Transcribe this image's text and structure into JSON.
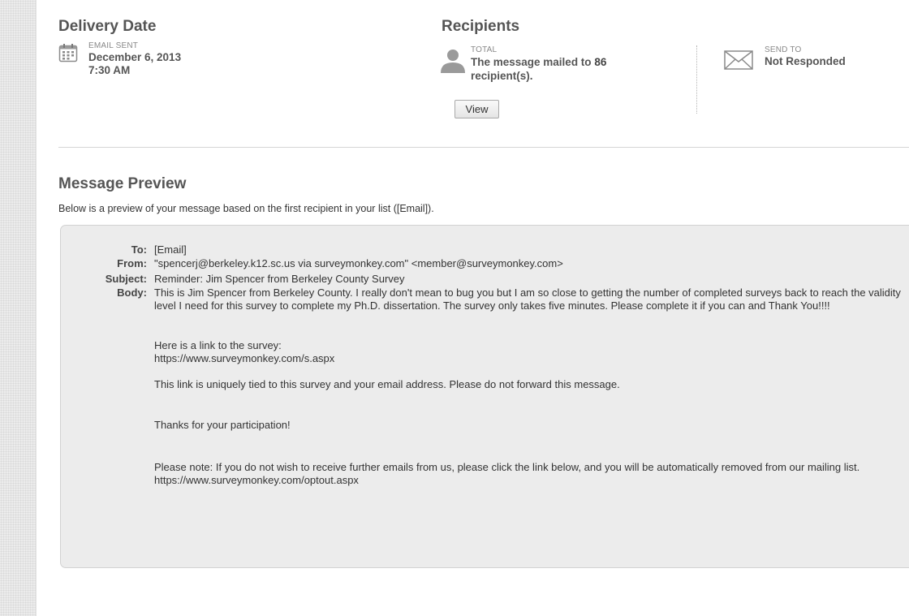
{
  "delivery": {
    "heading": "Delivery Date",
    "label": "EMAIL SENT",
    "date": "December 6, 2013",
    "time": "7:30 AM"
  },
  "recipients": {
    "heading": "Recipients",
    "total_label": "TOTAL",
    "message_prefix": "The message mailed to ",
    "count": "86",
    "message_suffix": " recipient(s).",
    "view_label": "View",
    "send_to_label": "SEND TO",
    "send_to_value": "Not Responded"
  },
  "preview": {
    "heading": "Message Preview",
    "description": "Below is a preview of your message based on the first recipient in your list ([Email]).",
    "to_label": "To:",
    "to_value": "[Email]",
    "from_label": "From:",
    "from_value": "\"spencerj@berkeley.k12.sc.us via surveymonkey.com\" <member@surveymonkey.com>",
    "subject_label": "Subject:",
    "subject_value": "Reminder:  Jim Spencer from Berkeley County Survey",
    "body_label": "Body:",
    "body": {
      "p1": "This is Jim Spencer from Berkeley County.  I really don't mean to bug you but I am so close to getting the number of completed surveys back to reach the validity level I need for this survey to complete my Ph.D. dissertation.  The survey only takes five minutes.  Please complete it if you can and Thank You!!!!",
      "p2_line1": "Here is a link to the survey:",
      "p2_link": "https://www.surveymonkey.com/s.aspx",
      "p3": "This link is uniquely tied to this survey and your email address. Please do not forward this message.",
      "p4": "Thanks for your participation!",
      "p5": "Please note: If you do not wish to receive further emails from us, please click the link below, and you will be automatically removed from our mailing list.",
      "p5_link": "https://www.surveymonkey.com/optout.aspx"
    }
  },
  "icons": {
    "calendar": "calendar-icon",
    "person": "person-icon",
    "envelope": "envelope-icon"
  },
  "colors": {
    "heading": "#555555",
    "preview_bg": "#ececec",
    "label_muted": "#888888"
  }
}
